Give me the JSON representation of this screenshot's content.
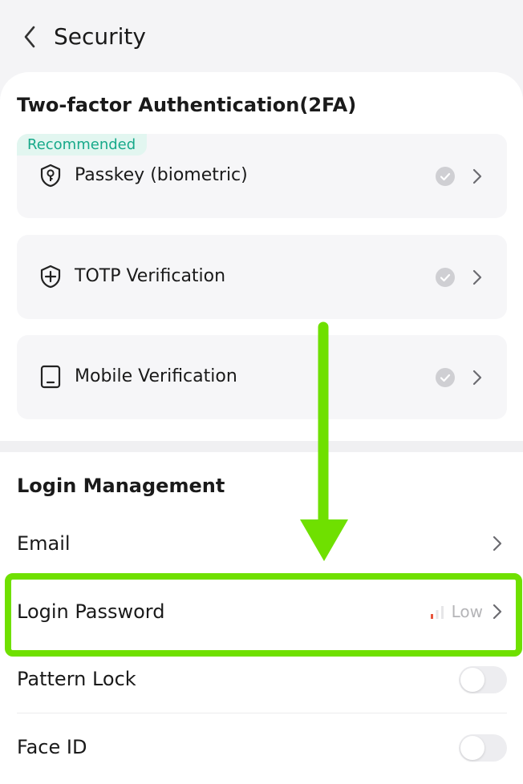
{
  "header": {
    "title": "Security",
    "back_icon": "chevron-left-icon"
  },
  "tfa": {
    "title": "Two-factor Authentication(2FA)",
    "badge": "Recommended",
    "items": [
      {
        "label": "Passkey (biometric)",
        "icon": "passkey-icon",
        "status_icon": "check-circle-icon"
      },
      {
        "label": "TOTP Verification",
        "icon": "shield-plus-icon",
        "status_icon": "check-circle-icon"
      },
      {
        "label": "Mobile Verification",
        "icon": "phone-icon",
        "status_icon": "check-circle-icon"
      }
    ]
  },
  "login": {
    "title": "Login Management",
    "rows": [
      {
        "label": "Email",
        "control": "chevron"
      },
      {
        "label": "Login Password",
        "control": "chevron",
        "strength": "Low"
      },
      {
        "label": "Pattern Lock",
        "control": "toggle",
        "on": false
      },
      {
        "label": "Face ID",
        "control": "toggle",
        "on": false
      }
    ]
  },
  "annotation": {
    "highlight_color": "#6fe000",
    "target": "Login Password"
  },
  "colors": {
    "accent_green": "#17a98a",
    "badge_bg": "#e2f6f0",
    "strength_low": "#e8553d"
  }
}
